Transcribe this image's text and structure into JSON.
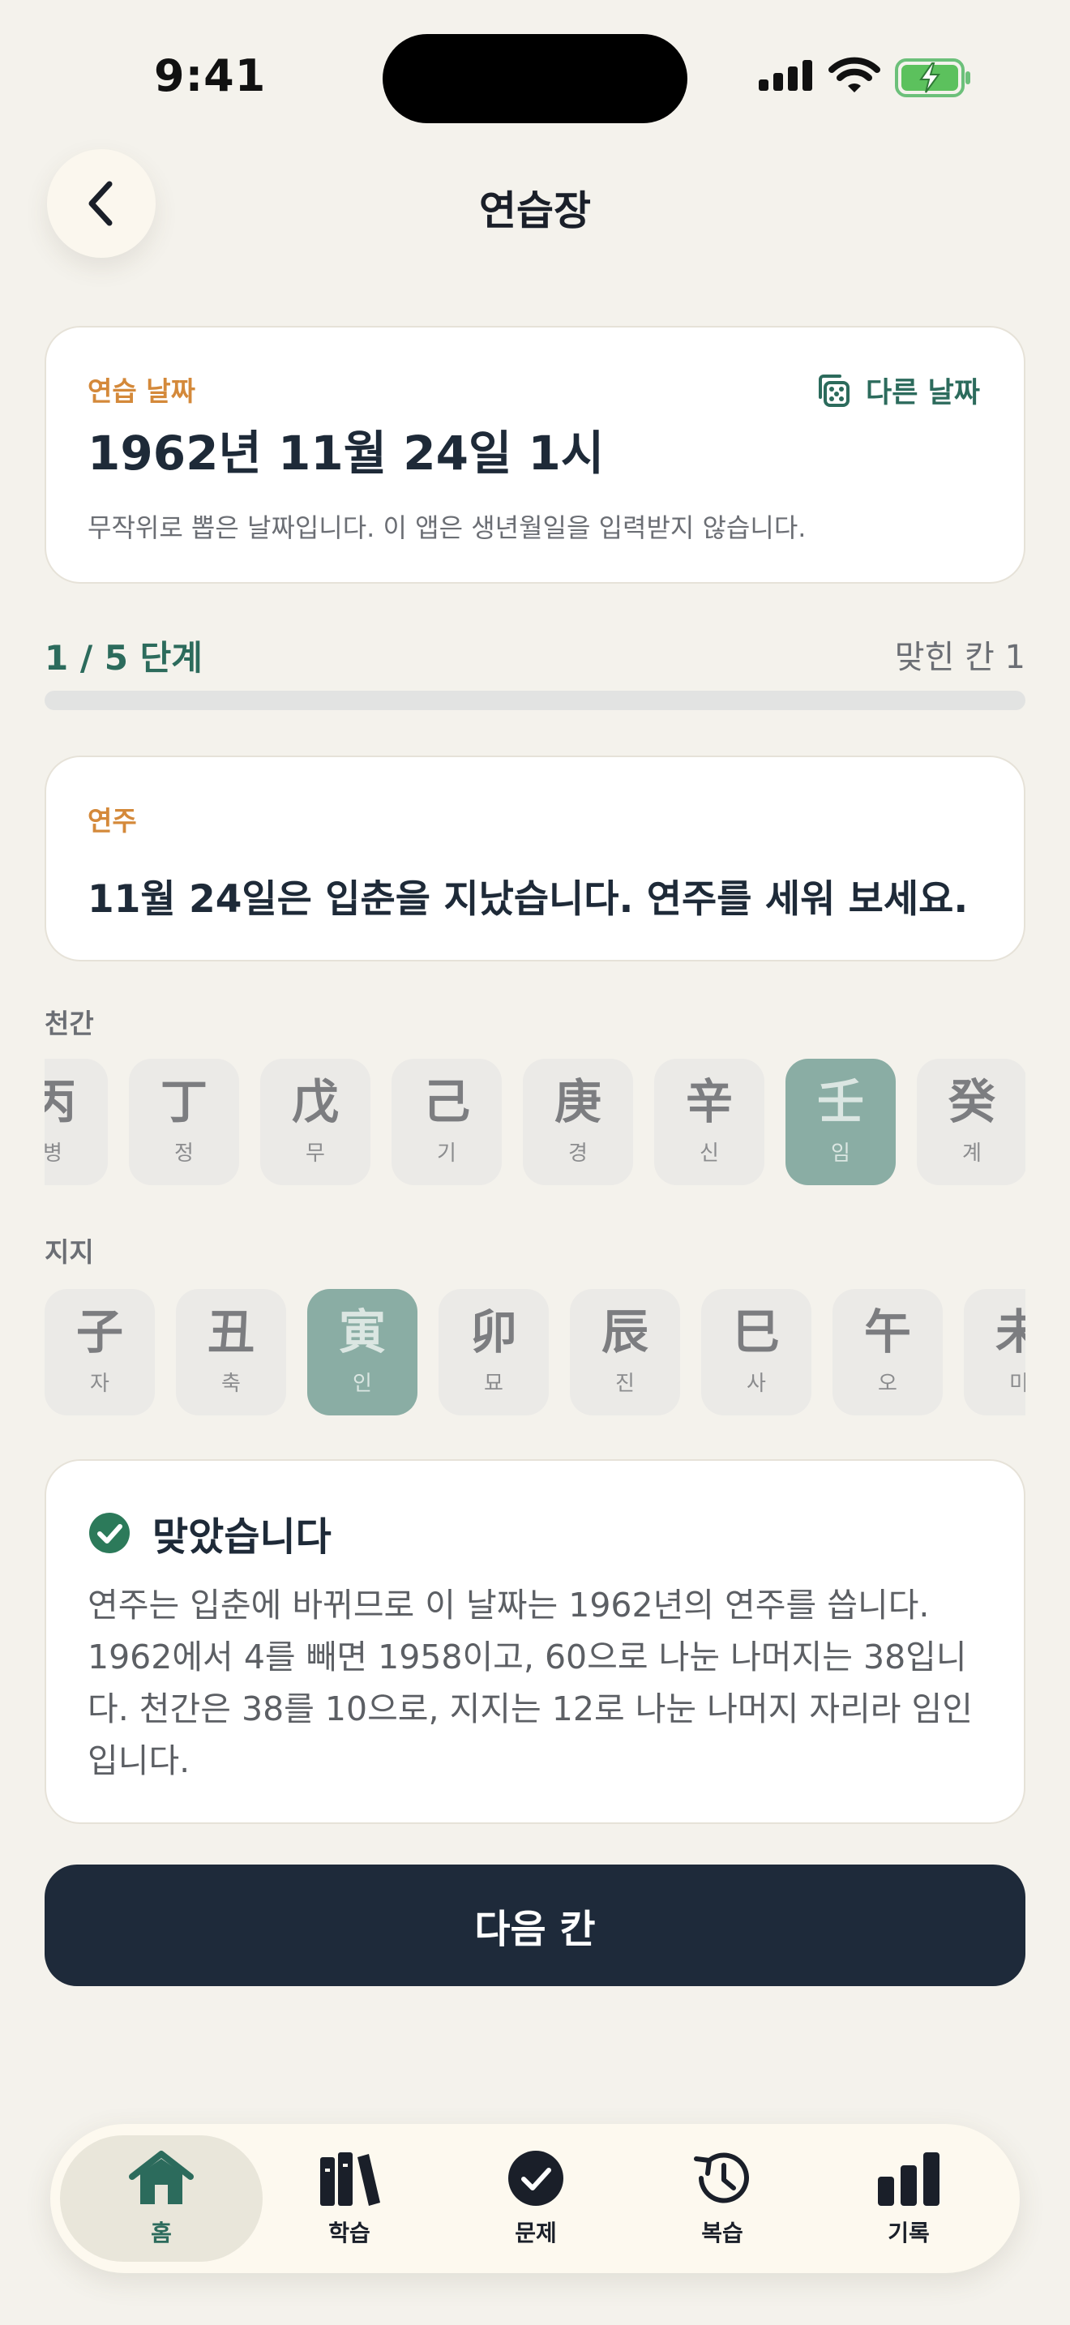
{
  "status_bar": {
    "time": "9:41"
  },
  "header": {
    "title": "연습장"
  },
  "date_card": {
    "label": "연습 날짜",
    "value": "1962년 11월 24일 1시",
    "note": "무작위로 뽑은 날짜입니다. 이 앱은 생년월일을 입력받지 않습니다.",
    "other_date_label": "다른 날짜"
  },
  "progress": {
    "step_text": "1 / 5 단계",
    "matched_text": "맞힌 칸 1",
    "fraction": 0.0
  },
  "question": {
    "label": "연주",
    "text": "11월 24일은 입춘을 지났습니다. 연주를 세워 보세요."
  },
  "heavenly_stems": {
    "label": "천간",
    "items": [
      {
        "hanja": "丙",
        "hangul": "병",
        "selected": false
      },
      {
        "hanja": "丁",
        "hangul": "정",
        "selected": false
      },
      {
        "hanja": "戊",
        "hangul": "무",
        "selected": false
      },
      {
        "hanja": "己",
        "hangul": "기",
        "selected": false
      },
      {
        "hanja": "庚",
        "hangul": "경",
        "selected": false
      },
      {
        "hanja": "辛",
        "hangul": "신",
        "selected": false
      },
      {
        "hanja": "壬",
        "hangul": "임",
        "selected": true
      },
      {
        "hanja": "癸",
        "hangul": "계",
        "selected": false
      }
    ]
  },
  "earthly_branches": {
    "label": "지지",
    "items": [
      {
        "hanja": "子",
        "hangul": "자",
        "selected": false
      },
      {
        "hanja": "丑",
        "hangul": "축",
        "selected": false
      },
      {
        "hanja": "寅",
        "hangul": "인",
        "selected": true
      },
      {
        "hanja": "卯",
        "hangul": "묘",
        "selected": false
      },
      {
        "hanja": "辰",
        "hangul": "진",
        "selected": false
      },
      {
        "hanja": "巳",
        "hangul": "사",
        "selected": false
      },
      {
        "hanja": "午",
        "hangul": "오",
        "selected": false
      },
      {
        "hanja": "未",
        "hangul": "미",
        "selected": false
      }
    ]
  },
  "answer": {
    "title": "맞았습니다",
    "body": "연주는 입춘에 바뀌므로 이 날짜는 1962년의 연주를 씁니다. 1962에서 4를 빼면 1958이고, 60으로 나눈 나머지는 38입니다. 천간은 38를 10으로, 지지는 12로 나눈 나머지 자리라 임인입니다."
  },
  "next_button": {
    "label": "다음 칸"
  },
  "tabbar": {
    "items": [
      {
        "label": "홈",
        "icon": "home-icon",
        "active": true
      },
      {
        "label": "학습",
        "icon": "books-icon",
        "active": false
      },
      {
        "label": "문제",
        "icon": "check-circle-icon",
        "active": false
      },
      {
        "label": "복습",
        "icon": "history-icon",
        "active": false
      },
      {
        "label": "기록",
        "icon": "bar-chart-icon",
        "active": false
      }
    ]
  },
  "colors": {
    "accent": "#2c6b5c",
    "label_orange": "#d4893a",
    "dark_button": "#1e2a3a",
    "background": "#f4f2ec",
    "selected_tile": "#8aada4"
  }
}
